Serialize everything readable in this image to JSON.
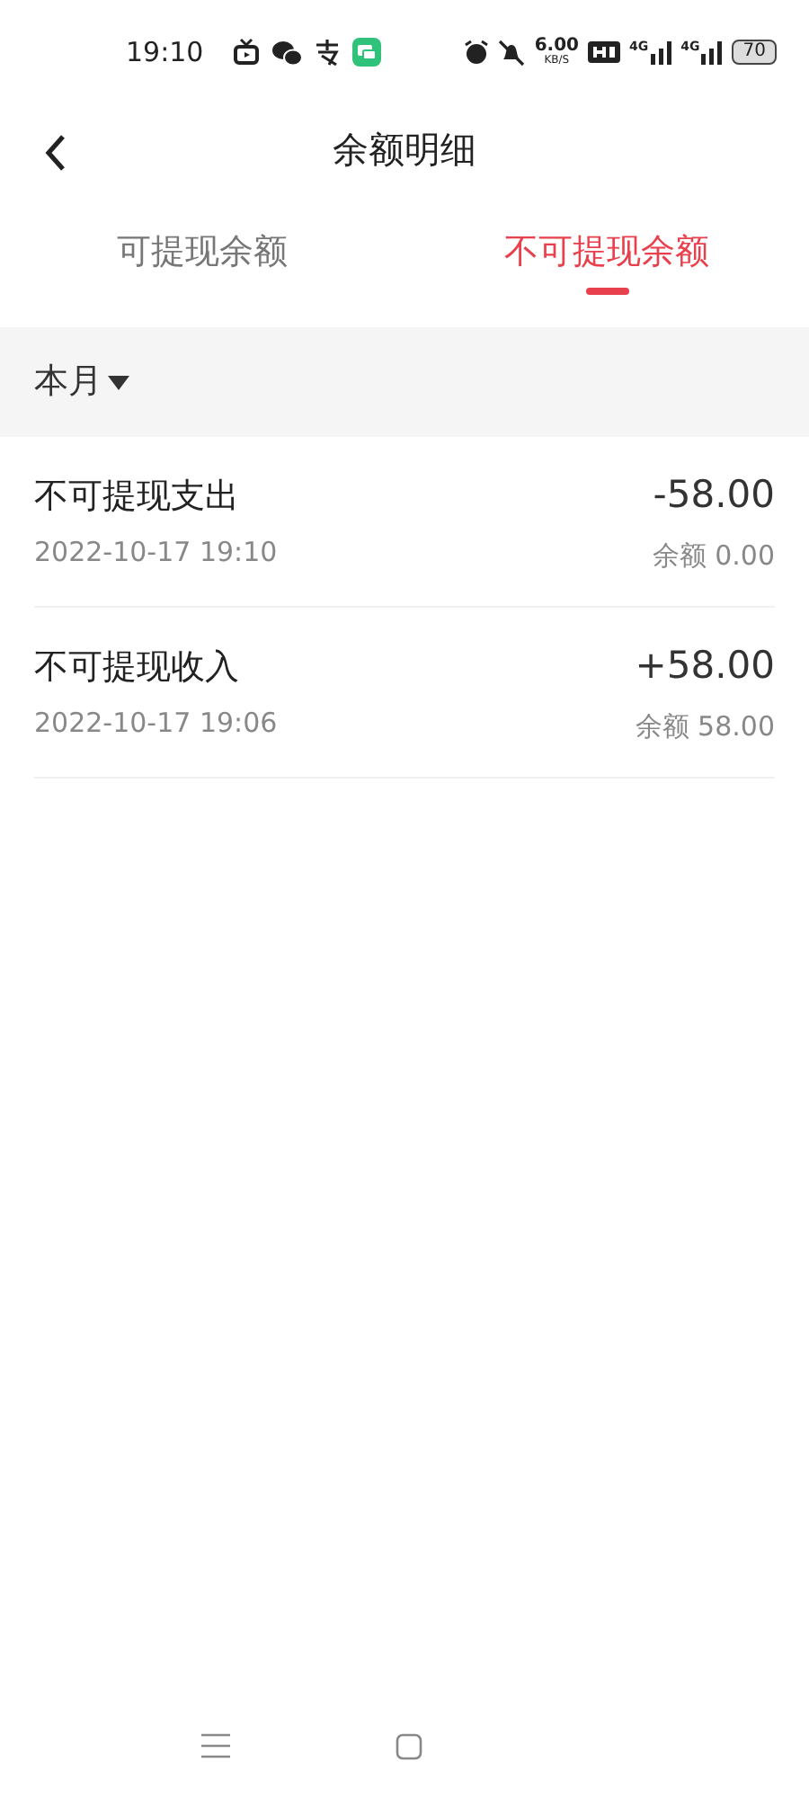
{
  "status_bar": {
    "time": "19:10",
    "speed": "6.00",
    "speed_unit": "KB/S",
    "network_1": "4G",
    "network_2": "4G",
    "battery": "70"
  },
  "header": {
    "title": "余额明细"
  },
  "tabs": [
    {
      "label": "可提现余额",
      "selected": false
    },
    {
      "label": "不可提现余额",
      "selected": true
    }
  ],
  "filter": {
    "label": "本月"
  },
  "records": [
    {
      "title": "不可提现支出",
      "time": "2022-10-17 19:10",
      "amount": "-58.00",
      "balance": "余额 0.00"
    },
    {
      "title": "不可提现收入",
      "time": "2022-10-17 19:06",
      "amount": "+58.00",
      "balance": "余额 58.00"
    }
  ]
}
